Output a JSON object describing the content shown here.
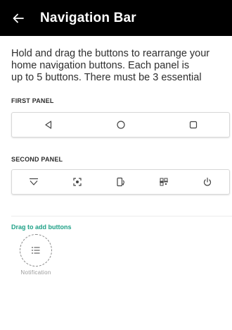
{
  "header": {
    "title": "Navigation Bar",
    "back_icon": "arrow-left-icon"
  },
  "description": "Hold and drag the buttons to rearrange your\nhome navigation buttons. Each panel is\nup to 5 buttons. There must be 3 essential",
  "first_panel": {
    "label": "FIRST PANEL",
    "buttons": [
      {
        "icon": "back-triangle-icon"
      },
      {
        "icon": "home-circle-icon"
      },
      {
        "icon": "recents-square-icon"
      }
    ]
  },
  "second_panel": {
    "label": "SECOND PANEL",
    "buttons": [
      {
        "icon": "hide-keyboard-icon"
      },
      {
        "icon": "screenshot-icon"
      },
      {
        "icon": "rotate-icon"
      },
      {
        "icon": "qr-scan-icon"
      },
      {
        "icon": "power-icon"
      }
    ]
  },
  "drag_section": {
    "label": "Drag to add buttons",
    "items": [
      {
        "label": "Notification",
        "icon": "notification-list-icon"
      }
    ]
  },
  "colors": {
    "app_bar": "#000000",
    "accent": "#1fa187",
    "icon": "#444444"
  }
}
